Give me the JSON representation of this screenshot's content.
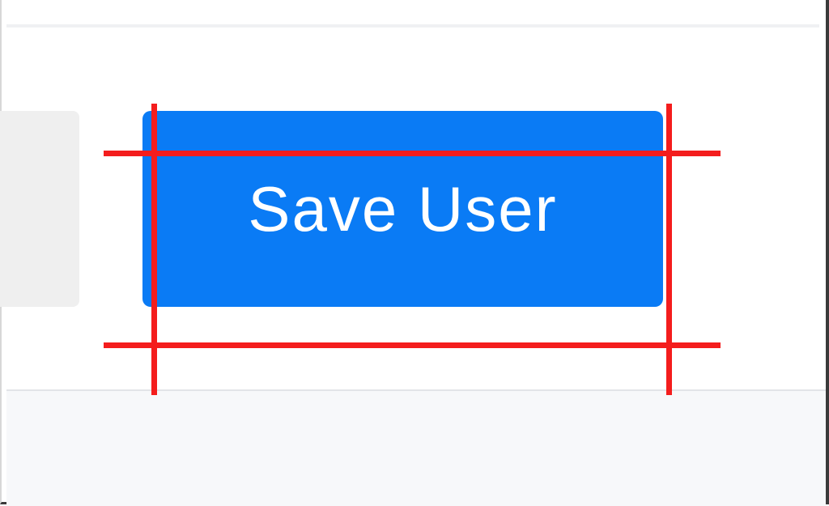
{
  "save_button": {
    "label": "Save User"
  },
  "colors": {
    "button_background": "#0a7bf5",
    "button_text": "#ffffff",
    "guide_line": "#f41d1d",
    "side_panel": "#efefef",
    "footer_background": "#f7f8fa"
  }
}
